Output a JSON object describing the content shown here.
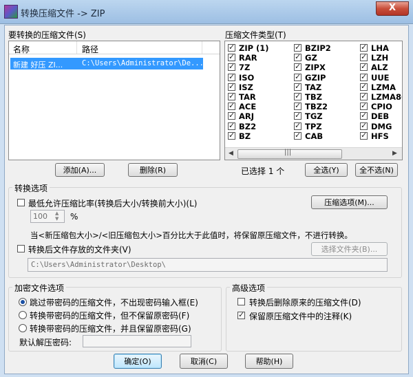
{
  "window": {
    "title": "转换压缩文件 -> ZIP",
    "close_glyph": "X"
  },
  "archives": {
    "label": "要转换的压缩文件(S)",
    "columns": [
      "名称",
      "路径"
    ],
    "rows": [
      {
        "name": "新建 好压 ZI...",
        "path": "C:\\Users\\Administrator\\De..."
      }
    ],
    "add_button": "添加(A)...",
    "delete_button": "删除(R)"
  },
  "types": {
    "label": "压缩文件类型(T)",
    "col1": [
      "ZIP (1)",
      "RAR",
      "7Z",
      "ISO",
      "ISZ",
      "TAR",
      "ACE",
      "ARJ",
      "BZ2",
      "BZ"
    ],
    "col2": [
      "BZIP2",
      "GZ",
      "ZIPX",
      "GZIP",
      "TAZ",
      "TBZ",
      "TBZ2",
      "TGZ",
      "TPZ",
      "CAB"
    ],
    "col3": [
      "LHA",
      "LZH",
      "ALZ",
      "UUE",
      "LZMA",
      "LZMA86",
      "CPIO",
      "DEB",
      "DMG",
      "HFS"
    ],
    "selected_text": "已选择 1 个",
    "select_all_button": "全选(Y)",
    "select_none_button": "全不选(N)"
  },
  "convert_options": {
    "label": "转换选项",
    "min_ratio_label": "最低允许压缩比率(转换后大小/转换前大小)(L)",
    "ratio_value": "100",
    "percent": "%",
    "compress_options_button": "压缩选项(M)...",
    "explanation": "当<新压缩包大小>/<旧压缩包大小>百分比大于此值时，将保留原压缩文件，不进行转换。",
    "save_folder_label": "转换后文件存放的文件夹(V)",
    "choose_folder_button": "选择文件夹(B)...",
    "folder_path": "C:\\Users\\Administrator\\Desktop\\"
  },
  "encryption": {
    "label": "加密文件选项",
    "options": [
      "跳过带密码的压缩文件，不出现密码输入框(E)",
      "转换带密码的压缩文件，但不保留原密码(F)",
      "转换带密码的压缩文件，并且保留原密码(G)"
    ],
    "selected_index": 0,
    "default_password_label": "默认解压密码:"
  },
  "advanced": {
    "label": "高级选项",
    "delete_original": {
      "label": "转换后删除原来的压缩文件(D)",
      "checked": false
    },
    "keep_comment": {
      "label": "保留原压缩文件中的注释(K)",
      "checked": true
    }
  },
  "footer": {
    "ok": "确定(O)",
    "cancel": "取消(C)",
    "help": "帮助(H)"
  }
}
